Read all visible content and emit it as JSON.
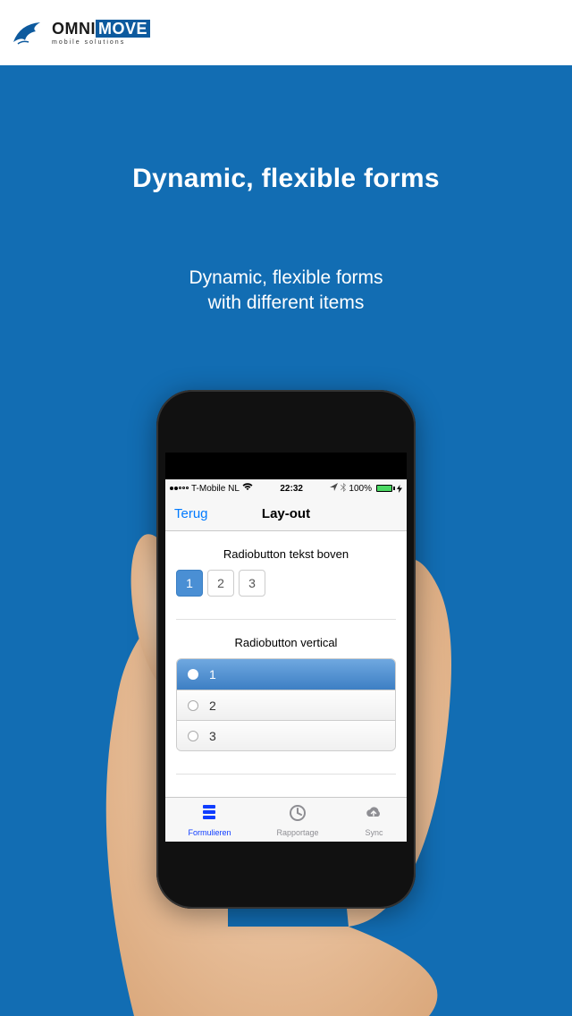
{
  "logo": {
    "brand_prefix": "OMNI",
    "brand_box": "MOVE",
    "tagline": "mobile solutions"
  },
  "hero": {
    "headline": "Dynamic, flexible forms",
    "sub_line1": "Dynamic, flexible forms",
    "sub_line2": "with different items"
  },
  "phone": {
    "status": {
      "carrier": "T-Mobile NL",
      "time": "22:32",
      "battery_pct": "100%"
    },
    "nav": {
      "back": "Terug",
      "title": "Lay-out"
    },
    "section1": {
      "label": "Radiobutton tekst boven",
      "opts": [
        "1",
        "2",
        "3"
      ],
      "selected": "1"
    },
    "section2": {
      "label": "Radiobutton vertical",
      "opts": [
        "1",
        "2",
        "3"
      ],
      "selected": "1"
    },
    "tabs": {
      "t0": "Formulieren",
      "t1": "Rapportage",
      "t2": "Sync"
    }
  }
}
